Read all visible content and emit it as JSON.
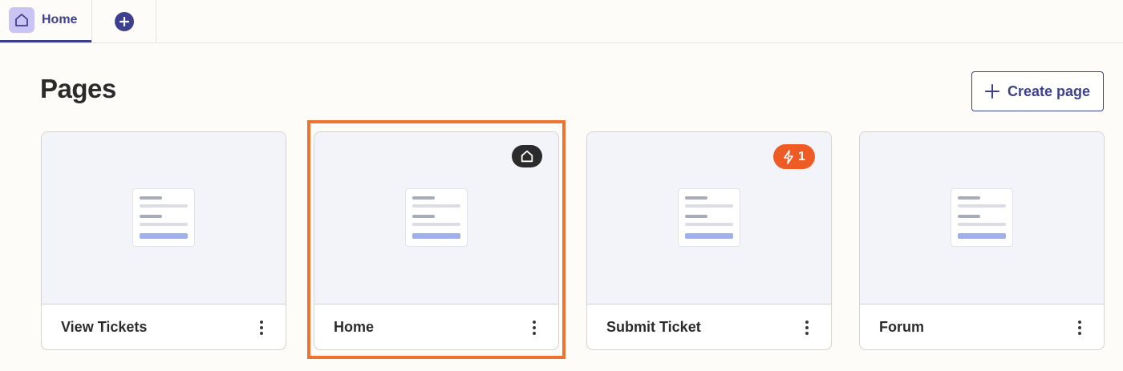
{
  "tabs": {
    "home_label": "Home",
    "home_icon": "home-icon",
    "add_icon": "plus-circle-icon"
  },
  "header": {
    "title": "Pages",
    "create_label": "Create page",
    "create_icon": "plus-icon"
  },
  "cards": [
    {
      "name": "View Tickets",
      "badge": null
    },
    {
      "name": "Home",
      "badge": "home-icon"
    },
    {
      "name": "Submit Ticket",
      "badge": "bolt-icon",
      "badge_count": "1"
    },
    {
      "name": "Forum",
      "badge": null
    }
  ],
  "colors": {
    "accent": "#3d3f8f",
    "highlight": "#ee7330",
    "badge_orange": "#ef5b25"
  }
}
